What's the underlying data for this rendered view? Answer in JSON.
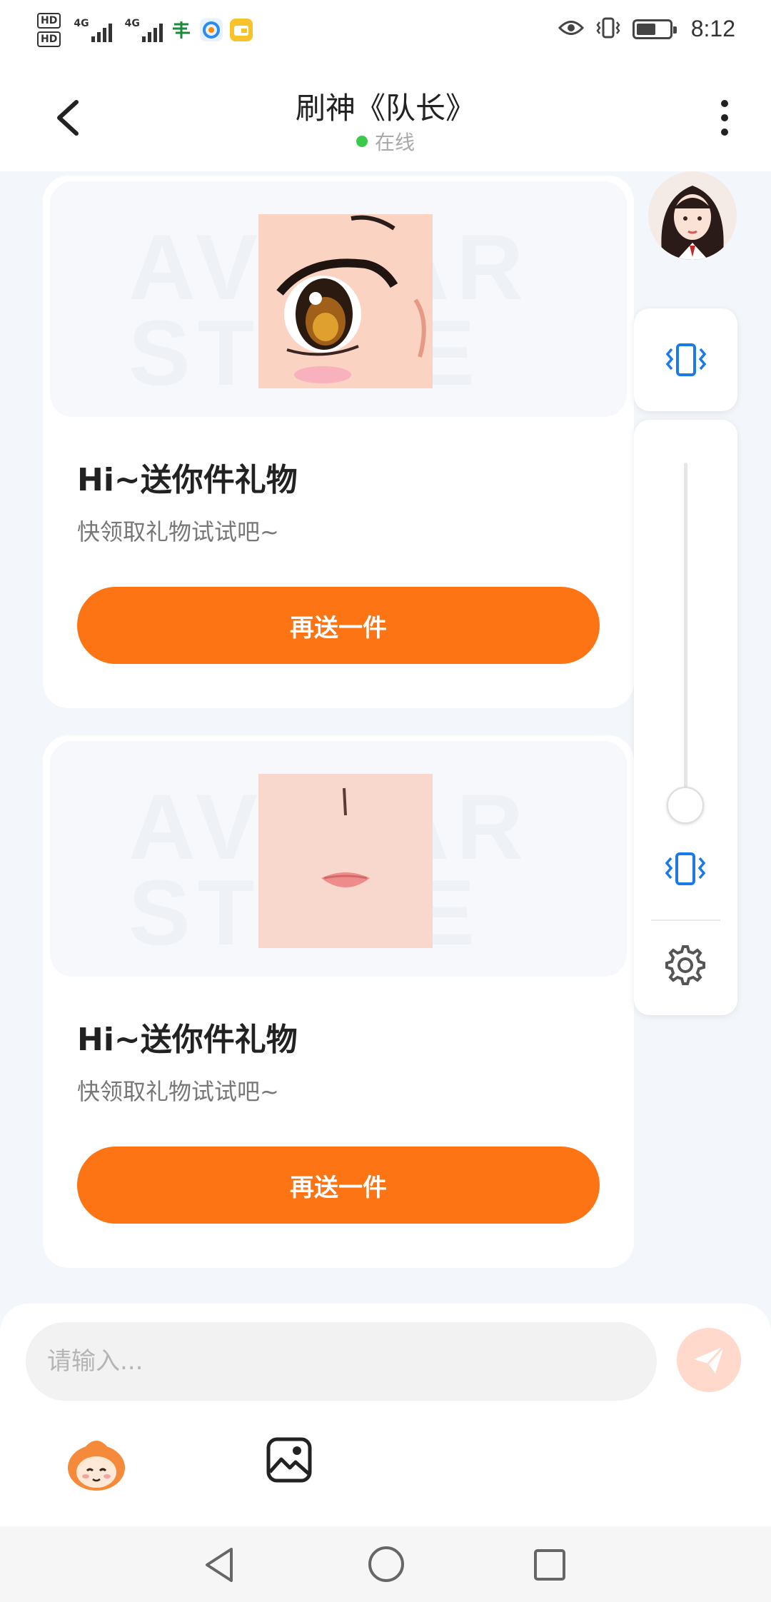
{
  "status_bar": {
    "time": "8:12",
    "hd1": "HD",
    "hd2": "HD",
    "net1": "4G",
    "net2": "4G"
  },
  "header": {
    "title": "刷神《队长》",
    "status": "在线"
  },
  "cards": [
    {
      "watermark": "AVATAR STORE",
      "title": "Hi~送你件礼物",
      "subtitle": "快领取礼物试试吧~",
      "button": "再送一件",
      "image": "anime-eye-icon"
    },
    {
      "watermark": "AVATAR STORE",
      "title": "Hi~送你件礼物",
      "subtitle": "快领取礼物试试吧~",
      "button": "再送一件",
      "image": "anime-lips-icon"
    }
  ],
  "side_panel": {
    "icons": [
      "vibrate-icon",
      "vibrate-icon",
      "gear-icon"
    ]
  },
  "input": {
    "placeholder": "请输入..."
  },
  "colors": {
    "accent": "#fd7414",
    "online": "#3bc94a",
    "icon_blue": "#1a7be8"
  }
}
